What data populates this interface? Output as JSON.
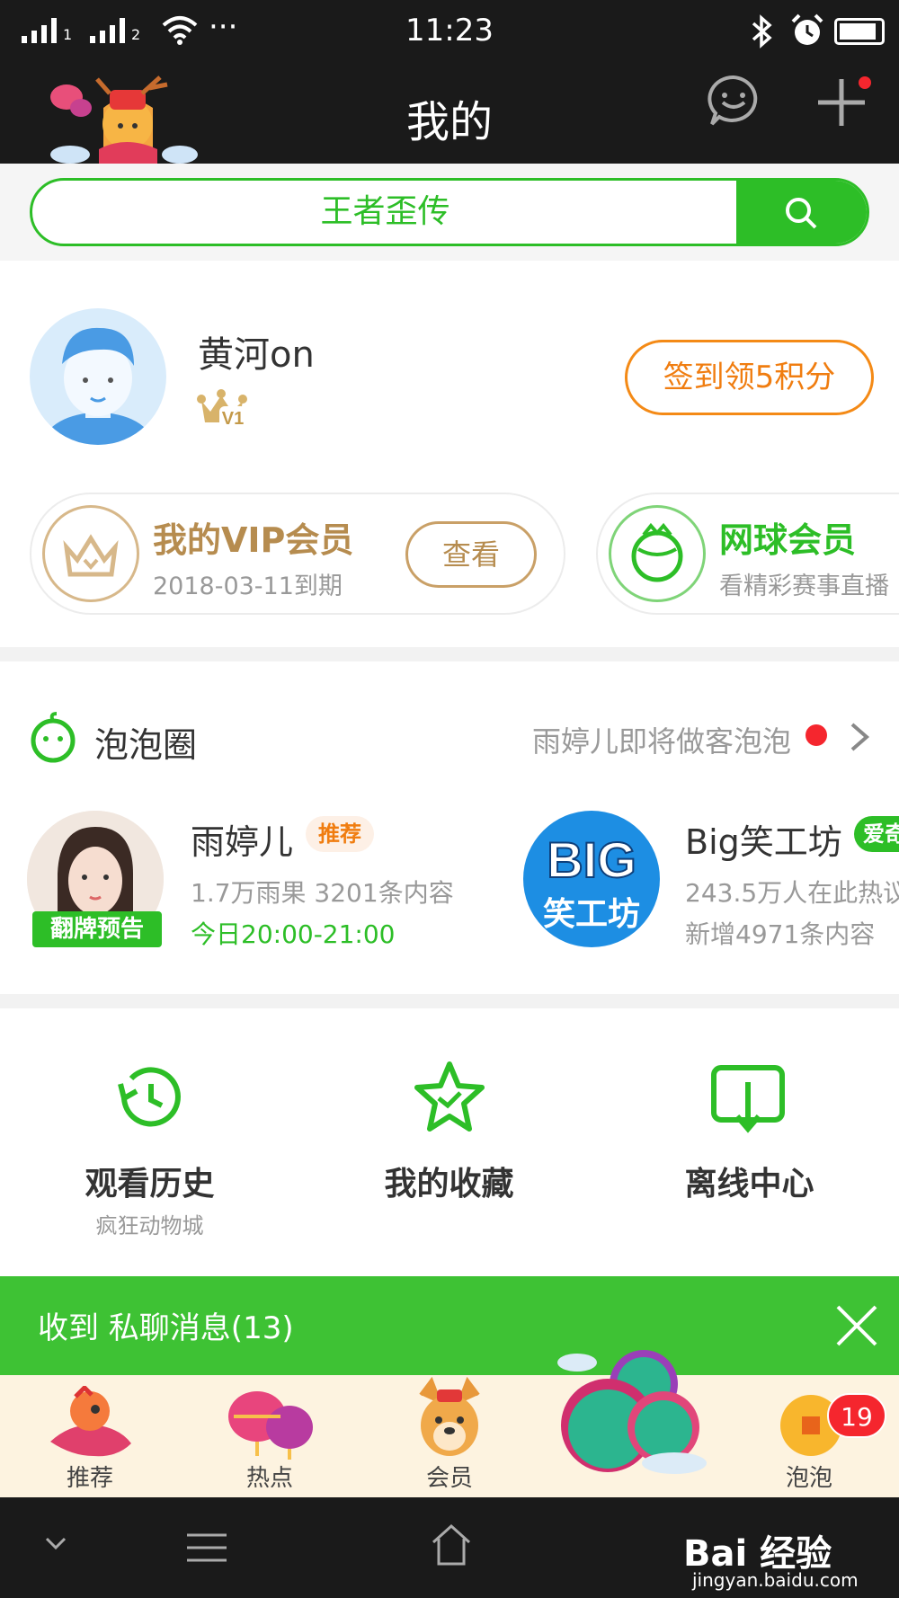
{
  "status_bar": {
    "time": "11:23",
    "sim1": "1",
    "sim2": "2",
    "more": "···"
  },
  "header": {
    "title": "我的"
  },
  "search": {
    "text": "王者歪传"
  },
  "profile": {
    "name": "黄河on",
    "level": "V1",
    "checkin_label": "签到领5积分"
  },
  "member_cards": [
    {
      "title": "我的VIP会员",
      "subtitle": "2018-03-11到期",
      "action": "查看",
      "color": "#b68c4f"
    },
    {
      "title": "网球会员",
      "subtitle": "看精彩赛事直播",
      "color": "#2dbe27"
    }
  ],
  "bubble_circle": {
    "title": "泡泡圈",
    "more_text": "雨婷儿即将做客泡泡",
    "items": [
      {
        "name": "雨婷儿",
        "tag": "推荐",
        "stats": "1.7万雨果 3201条内容",
        "extra": "今日20:00-21:00",
        "avatar_badge": "翻牌预告"
      },
      {
        "name": "Big笑工坊",
        "tag": "爱奇",
        "stats": "243.5万人在此热议",
        "extra": "新增4971条内容",
        "avatar_text_1": "BIG",
        "avatar_text_2": "笑工坊"
      }
    ]
  },
  "functions": [
    {
      "label": "观看历史",
      "sub": "疯狂动物城"
    },
    {
      "label": "我的收藏",
      "sub": ""
    },
    {
      "label": "离线中心",
      "sub": ""
    }
  ],
  "toast": {
    "message": "收到 私聊消息(13)"
  },
  "tabbar": {
    "tabs": [
      {
        "label": "推荐"
      },
      {
        "label": "热点"
      },
      {
        "label": "会员"
      },
      {
        "label": ""
      },
      {
        "label": "泡泡"
      }
    ],
    "badge": "19"
  },
  "watermark": {
    "brand": "Bai 经验",
    "url": "jingyan.baidu.com"
  },
  "colors": {
    "accent": "#2dbe27",
    "orange": "#f07d10",
    "gold": "#b68c4f",
    "dark": "#1a1a1a"
  }
}
